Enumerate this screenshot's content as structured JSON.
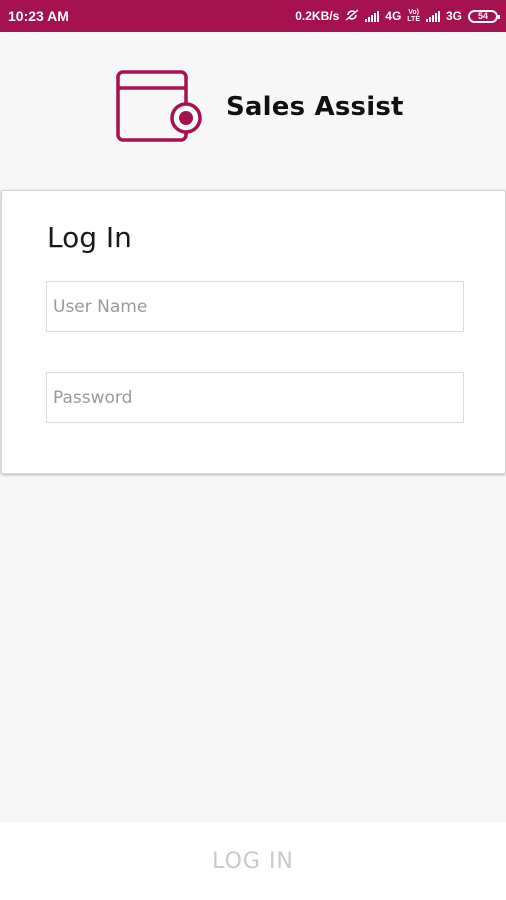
{
  "status_bar": {
    "time": "10:23 AM",
    "speed": "0.2KB/s",
    "net1": "4G",
    "volte_top": "Vo)",
    "volte_bottom": "LTE",
    "net2": "3G",
    "battery": "54"
  },
  "brand": {
    "name": "Sales Assist",
    "logo_icon": "wallet-icon",
    "color": "#a6124f"
  },
  "login_card": {
    "title": "Log In",
    "username_placeholder": "User Name",
    "username_value": "",
    "password_placeholder": "Password",
    "password_value": ""
  },
  "footer": {
    "login_label": "LOG IN"
  }
}
